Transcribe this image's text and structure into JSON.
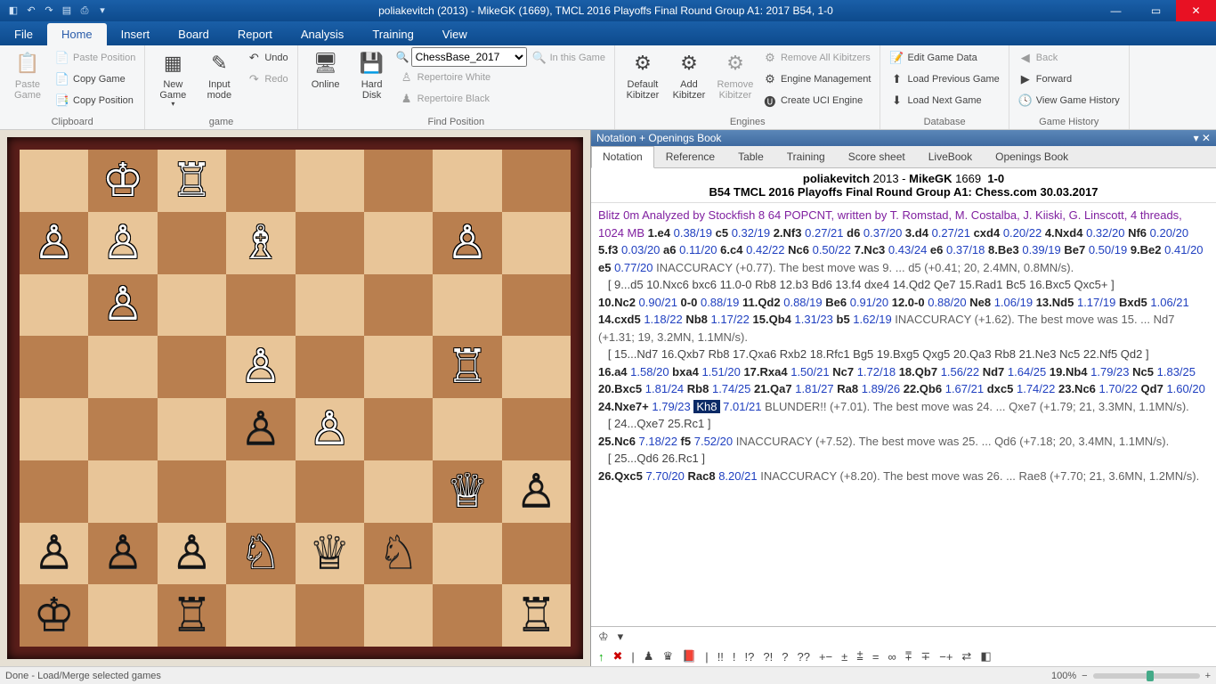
{
  "title": "poliakevitch (2013) - MikeGK (1669), TMCL 2016 Playoffs Final Round Group A1: 2017  B54, 1-0",
  "menu": [
    "File",
    "Home",
    "Insert",
    "Board",
    "Report",
    "Analysis",
    "Training",
    "View"
  ],
  "activeMenu": "Home",
  "ribbon": {
    "clipboard": {
      "label": "Clipboard",
      "paste": "Paste Game",
      "pastePos": "Paste Position",
      "copyGame": "Copy Game",
      "copyPos": "Copy Position"
    },
    "game": {
      "label": "game",
      "new": "New Game",
      "input": "Input mode",
      "undo": "Undo",
      "redo": "Redo"
    },
    "find": {
      "label": "Find Position",
      "online": "Online",
      "hard": "Hard Disk",
      "select": "ChessBase_2017",
      "inGame": "In this Game",
      "repW": "Repertoire White",
      "repB": "Repertoire Black"
    },
    "engines": {
      "label": "Engines",
      "default": "Default Kibitzer",
      "add": "Add Kibitzer",
      "remove": "Remove Kibitzer",
      "removeAll": "Remove All Kibitzers",
      "mgmt": "Engine Management",
      "uci": "Create UCI Engine"
    },
    "db": {
      "label": "Database",
      "edit": "Edit Game Data",
      "prev": "Load Previous Game",
      "next": "Load Next Game"
    },
    "hist": {
      "label": "Game History",
      "back": "Back",
      "fwd": "Forward",
      "view": "View Game History"
    }
  },
  "board": {
    "fen_rows": [
      ".kr.....",
      "pp.b..p.",
      ".p......",
      "...P..R.",
      "..+P....",
      "......Q+",
      "++++N+q+n",
      ".+k.+r..+r"
    ],
    "squares": [
      [
        "",
        "wK",
        "wR",
        "",
        "",
        "",
        "",
        ""
      ],
      [
        "wP",
        "wP",
        "",
        "wB",
        "",
        "",
        "wP",
        ""
      ],
      [
        "",
        "wP",
        "",
        "",
        "",
        "",
        "",
        ""
      ],
      [
        "",
        "",
        "",
        "wP",
        "",
        "",
        "wR",
        ""
      ],
      [
        "",
        "",
        "",
        "bP",
        "wP",
        "",
        "",
        ""
      ],
      [
        "",
        "",
        "",
        "",
        "",
        "",
        "wQ",
        "bP"
      ],
      [
        "bP",
        "bP",
        "bP",
        "wN",
        "bQ",
        "bN",
        "",
        ""
      ],
      [
        "bK",
        "",
        "bR",
        "",
        "",
        "",
        "",
        "bR"
      ]
    ]
  },
  "panel": {
    "title": "Notation + Openings Book",
    "tabs": [
      "Notation",
      "Reference",
      "Table",
      "Training",
      "Score sheet",
      "LiveBook",
      "Openings Book"
    ],
    "activeTab": "Notation",
    "headerLine1_a": "poliakevitch",
    "headerLine1_b": "2013",
    "headerLine1_c": "MikeGK",
    "headerLine1_d": "1669",
    "headerLine1_e": "1-0",
    "headerLine2": "B54 TMCL 2016 Playoffs Final Round Group A1: Chess.com 30.03.2017"
  },
  "notation": {
    "intro": "Blitz 0m Analyzed by Stockfish 8 64 POPCNT, written by T. Romstad, M. Costalba, J. Kiiski, G. Linscott, 4 threads, 1024 MB",
    "line1": [
      {
        "m": "1.e4",
        "e": "0.38/19"
      },
      {
        "m": "c5",
        "e": "0.32/19"
      },
      {
        "m": "2.Nf3",
        "e": "0.27/21"
      },
      {
        "m": "d6",
        "e": "0.37/20"
      },
      {
        "m": "3.d4",
        "e": "0.27/21"
      },
      {
        "m": "cxd4",
        "e": "0.20/22"
      },
      {
        "m": "4.Nxd4",
        "e": "0.32/20"
      },
      {
        "m": "Nf6",
        "e": "0.20/20"
      },
      {
        "m": "5.f3",
        "e": "0.03/20"
      },
      {
        "m": "a6",
        "e": "0.11/20"
      },
      {
        "m": "6.c4",
        "e": "0.42/22"
      },
      {
        "m": "Nc6",
        "e": "0.50/22"
      },
      {
        "m": "7.Nc3",
        "e": "0.43/24"
      },
      {
        "m": "e6",
        "e": "0.37/18"
      },
      {
        "m": "8.Be3",
        "e": "0.39/19"
      },
      {
        "m": "Be7",
        "e": "0.50/19"
      },
      {
        "m": "9.Be2",
        "e": "0.41/20"
      },
      {
        "m": "e5",
        "e": "0.77/20"
      }
    ],
    "inacc9": "INACCURACY (+0.77). The best move was 9. ... d5 (+0.41; 20, 2.4MN, 0.8MN/s).",
    "var9": "[ 9...d5  10.Nxc6  bxc6  11.0-0  Rb8  12.b3  Bd6  13.f4  dxe4  14.Qd2  Qe7  15.Rad1  Bc5  16.Bxc5  Qxc5+ ]",
    "line2": [
      {
        "m": "10.Nc2",
        "e": "0.90/21"
      },
      {
        "m": "0-0",
        "e": "0.88/19"
      },
      {
        "m": "11.Qd2",
        "e": "0.88/19"
      },
      {
        "m": "Be6",
        "e": "0.91/20"
      },
      {
        "m": "12.0-0",
        "e": "0.88/20"
      },
      {
        "m": "Ne8",
        "e": "1.06/19"
      },
      {
        "m": "13.Nd5",
        "e": "1.17/19"
      },
      {
        "m": "Bxd5",
        "e": "1.06/21"
      },
      {
        "m": "14.cxd5",
        "e": "1.18/22"
      },
      {
        "m": "Nb8",
        "e": "1.17/22"
      },
      {
        "m": "15.Qb4",
        "e": "1.31/23"
      },
      {
        "m": "b5",
        "e": "1.62/19"
      }
    ],
    "inacc15": "INACCURACY (+1.62). The best move was 15. ... Nd7 (+1.31; 19, 3.2MN, 1.1MN/s).",
    "var15": "[ 15...Nd7  16.Qxb7  Rb8  17.Qxa6  Rxb2  18.Rfc1  Bg5  19.Bxg5  Qxg5  20.Qa3  Rb8  21.Ne3  Nc5  22.Nf5  Qd2 ]",
    "line3": [
      {
        "m": "16.a4",
        "e": "1.58/20"
      },
      {
        "m": "bxa4",
        "e": "1.51/20"
      },
      {
        "m": "17.Rxa4",
        "e": "1.50/21"
      },
      {
        "m": "Nc7",
        "e": "1.72/18"
      },
      {
        "m": "18.Qb7",
        "e": "1.56/22"
      },
      {
        "m": "Nd7",
        "e": "1.64/25"
      },
      {
        "m": "19.Nb4",
        "e": "1.79/23"
      },
      {
        "m": "Nc5",
        "e": "1.83/25"
      },
      {
        "m": "20.Bxc5",
        "e": "1.81/24"
      },
      {
        "m": "Rb8",
        "e": "1.74/25"
      },
      {
        "m": "21.Qa7",
        "e": "1.81/27"
      },
      {
        "m": "Ra8",
        "e": "1.89/26"
      },
      {
        "m": "22.Qb6",
        "e": "1.67/21"
      },
      {
        "m": "dxc5",
        "e": "1.74/22"
      },
      {
        "m": "23.Nc6",
        "e": "1.70/22"
      },
      {
        "m": "Qd7",
        "e": "1.60/20"
      },
      {
        "m": "24.Nxe7+",
        "e": "1.79/23"
      }
    ],
    "hlMove": "Kh8",
    "hlEval": "7.01/21",
    "blunder": "BLUNDER!! (+7.01). The best move was 24. ... Qxe7 (+1.79; 21, 3.3MN, 1.1MN/s).",
    "var24": "[ 24...Qxe7  25.Rc1 ]",
    "line4": [
      {
        "m": "25.Nc6",
        "e": "7.18/22"
      },
      {
        "m": "f5",
        "e": "7.52/20"
      }
    ],
    "inacc25": "INACCURACY (+7.52). The best move was 25. ... Qd6 (+7.18; 20, 3.4MN, 1.1MN/s).",
    "var25": "[ 25...Qd6  26.Rc1 ]",
    "line5": [
      {
        "m": "26.Qxc5",
        "e": "7.70/20"
      },
      {
        "m": "Rac8",
        "e": "8.20/21"
      }
    ],
    "inacc26": "INACCURACY (+8.20). The best move was 26. ... Rae8 (+7.70; 21, 3.6MN, 1.2MN/s)."
  },
  "status": "Done - Load/Merge selected games",
  "zoom": "100%"
}
